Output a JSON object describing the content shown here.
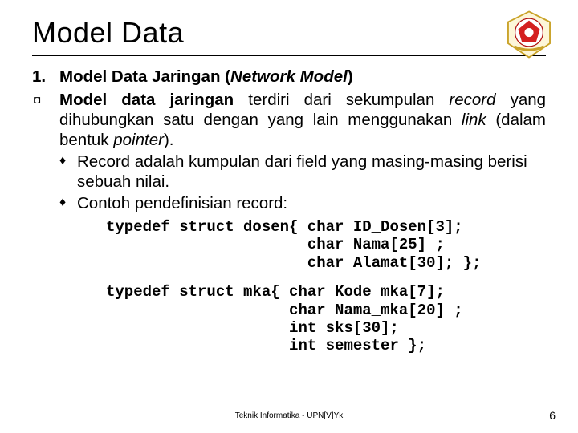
{
  "title": "Model Data",
  "item1": {
    "number": "1.",
    "plain1": "Model Data Jaringan (",
    "italic": "Network Model",
    "plain2": ")"
  },
  "body": {
    "b1": "Model data jaringan",
    "t1": " terdiri dari sekumpulan ",
    "i1": "record",
    "t2": " yang dihubungkan satu dengan yang lain menggunakan ",
    "i2": "link",
    "t3": " (dalam bentuk ",
    "i3": "pointer",
    "t4": ")."
  },
  "sub1": "Record adalah kumpulan dari field yang masing-masing berisi sebuah nilai.",
  "sub2": "Contoh pendefinisian record:",
  "code1": "typedef struct dosen{ char ID_Dosen[3];\n                      char Nama[25] ;\n                      char Alamat[30]; };",
  "code2": "typedef struct mka{ char Kode_mka[7];\n                    char Nama_mka[20] ;\n                    int sks[30];\n                    int semester };",
  "footer": "Teknik Informatika - UPN[V]Yk",
  "page": "6"
}
